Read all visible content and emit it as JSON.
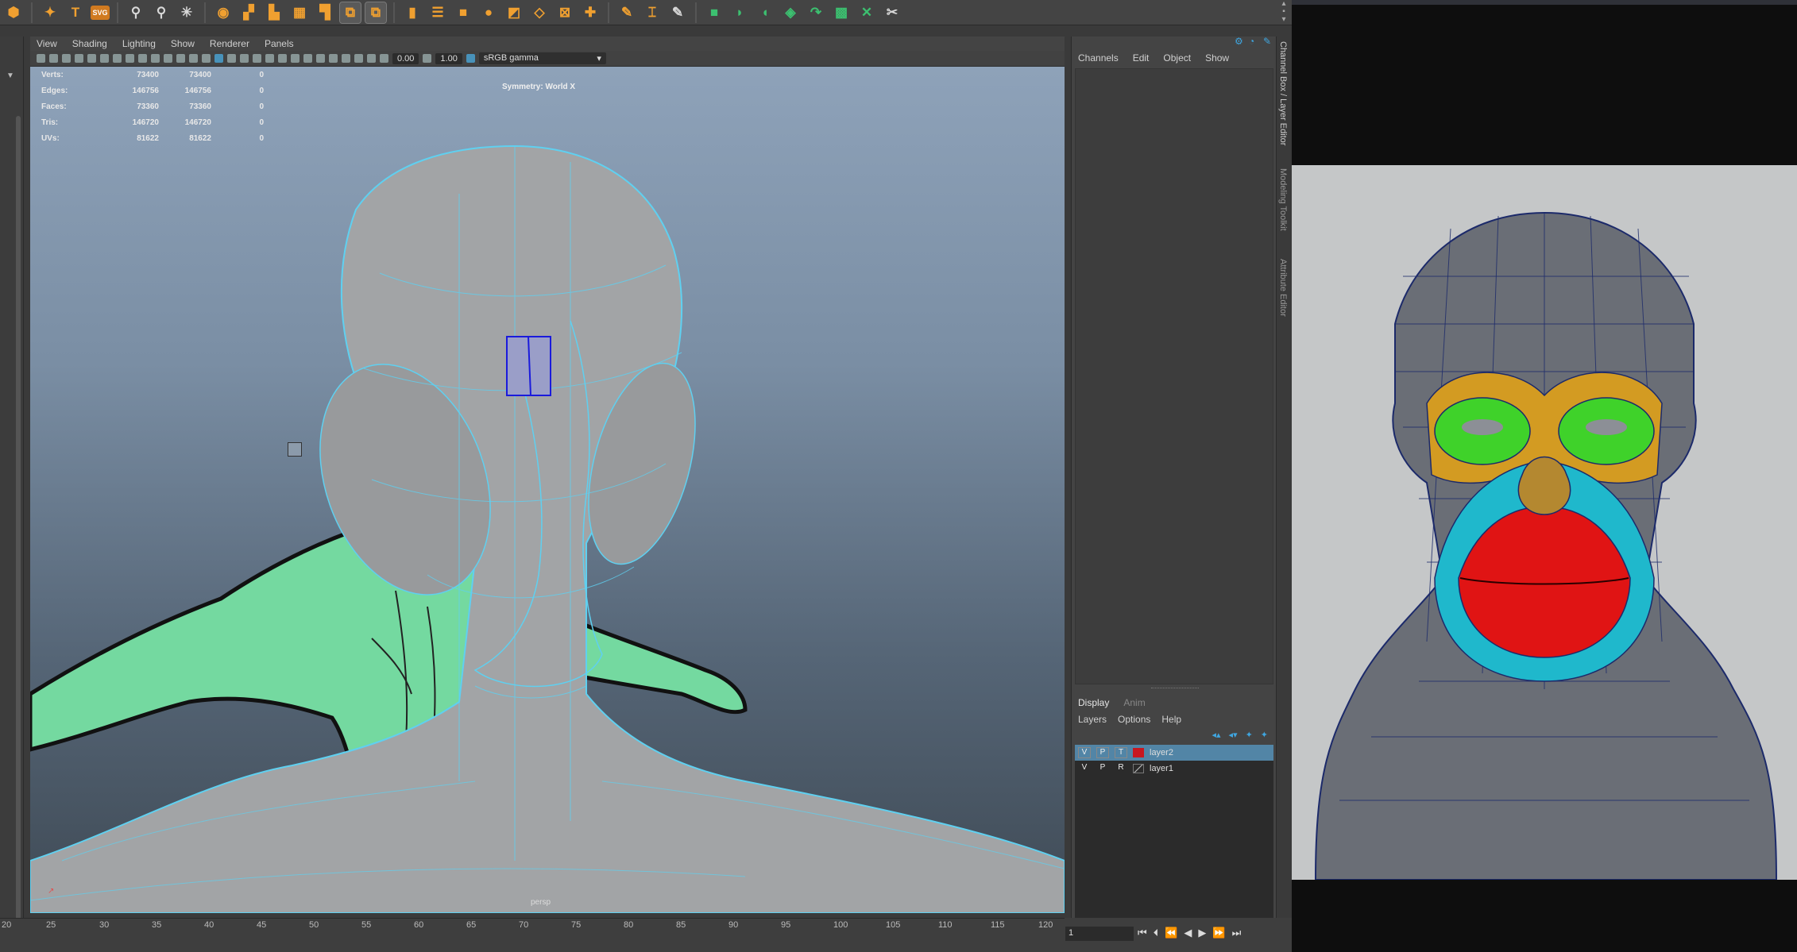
{
  "viewport_menu": [
    "View",
    "Shading",
    "Lighting",
    "Show",
    "Renderer",
    "Panels"
  ],
  "toolbar": {
    "value_a": "0.00",
    "value_b": "1.00",
    "color_space": "sRGB gamma"
  },
  "hud": {
    "rows": [
      {
        "label": "Verts:",
        "v1": "73400",
        "v2": "73400",
        "v3": "0"
      },
      {
        "label": "Edges:",
        "v1": "146756",
        "v2": "146756",
        "v3": "0"
      },
      {
        "label": "Faces:",
        "v1": "73360",
        "v2": "73360",
        "v3": "0"
      },
      {
        "label": "Tris:",
        "v1": "146720",
        "v2": "146720",
        "v3": "0"
      },
      {
        "label": "UVs:",
        "v1": "81622",
        "v2": "81622",
        "v3": "0"
      }
    ],
    "symmetry": "Symmetry: World X",
    "camera": "persp"
  },
  "channel_box": {
    "menu": [
      "Channels",
      "Edit",
      "Object",
      "Show"
    ]
  },
  "layer_editor": {
    "tabs": {
      "display": "Display",
      "anim": "Anim"
    },
    "menu": [
      "Layers",
      "Options",
      "Help"
    ],
    "layers": [
      {
        "v": "V",
        "p": "P",
        "t": "T",
        "name": "layer2",
        "color": "#c8171f",
        "selected": true
      },
      {
        "v": "V",
        "p": "P",
        "t": "R",
        "name": "layer1",
        "color": "none",
        "selected": false
      }
    ]
  },
  "side_tabs": [
    "Channel Box / Layer Editor",
    "Modeling Toolkit",
    "Attribute Editor"
  ],
  "timeline": {
    "ticks": [
      "20",
      "25",
      "30",
      "35",
      "40",
      "45",
      "50",
      "55",
      "60",
      "65",
      "70",
      "75",
      "80",
      "85",
      "90",
      "95",
      "100",
      "105",
      "110",
      "115",
      "120"
    ],
    "current_frame": "1"
  },
  "shelf_icons": [
    "polygon-icon",
    "star-icon",
    "text-icon",
    "svg-icon",
    "sculpt-icon",
    "soft-select-icon",
    "pivot-icon",
    "extrude-icon"
  ],
  "colors": {
    "accent": "#3fa6e0",
    "wire": "#5fd0f0",
    "selection": "#5285a6",
    "layer2": "#c8171f"
  }
}
